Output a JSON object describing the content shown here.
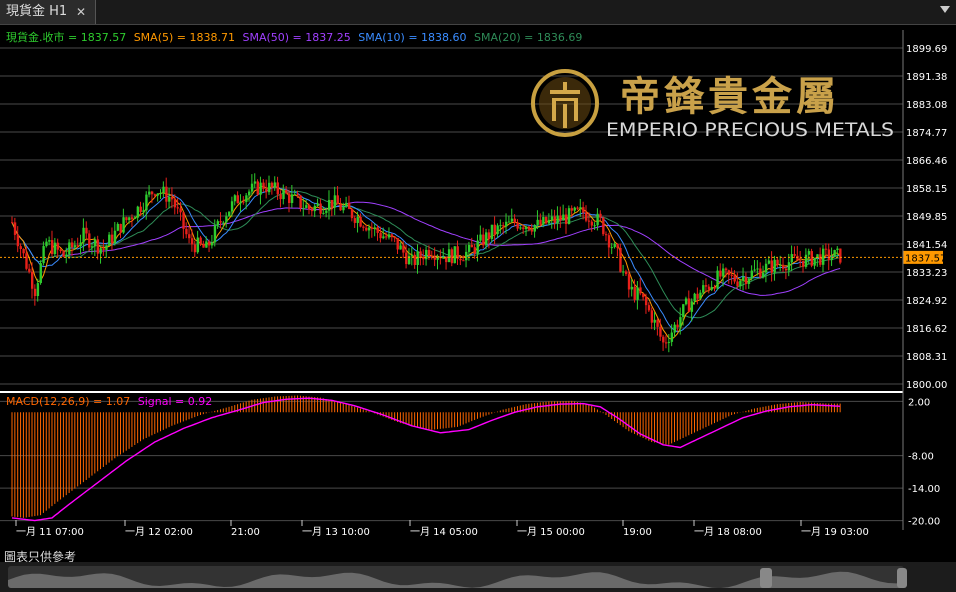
{
  "window": {
    "tab_title": "現貨金 H1",
    "close_glyph": "✕",
    "footer_text": "圖表只供參考"
  },
  "logo": {
    "chinese": "帝鋒貴金屬",
    "english": "EMPERIO PRECIOUS METALS"
  },
  "legend": {
    "price": "現貨金.收市 = 1837.57",
    "sma5": "SMA(5) = 1838.71",
    "sma50": "SMA(50) = 1837.25",
    "sma10": "SMA(10) = 1838.60",
    "sma20": "SMA(20) = 1836.69"
  },
  "macd_legend": {
    "macd": "MACD(12,26,9) = 1.07",
    "signal": "Signal = 0.92"
  },
  "colors": {
    "up": "#2ecc2e",
    "down": "#e8201a",
    "price_line": "#ff9900",
    "sma5": "#ff9900",
    "sma10": "#3a8cff",
    "sma20": "#2e8b57",
    "sma50": "#a040ff",
    "macd_hist": "#ff6600",
    "signal": "#ff00ff",
    "grid": "#4a4a4a",
    "axis_text": "#ffffff"
  },
  "chart_data": {
    "type": "candlestick",
    "timeframe": "H1",
    "instrument": "現貨金",
    "current_price": 1837.57,
    "current_price_label": "1837.57",
    "y_ticks": [
      "1899.69",
      "1891.38",
      "1883.08",
      "1874.77",
      "1866.46",
      "1858.15",
      "1849.85",
      "1841.54",
      "1833.23",
      "1824.92",
      "1816.62",
      "1808.31",
      "1800.00"
    ],
    "ylim": [
      1800.0,
      1899.69
    ],
    "x_tick_labels": [
      "一月 11 07:00",
      "一月 12 02:00",
      "21:00",
      "一月 13 10:00",
      "一月 14 05:00",
      "一月 15 00:00",
      "19:00",
      "一月 18 08:00",
      "一月 19 03:00"
    ],
    "price_anchors": [
      [
        0,
        1848
      ],
      [
        4,
        1838
      ],
      [
        8,
        1828
      ],
      [
        12,
        1842
      ],
      [
        18,
        1838
      ],
      [
        25,
        1844
      ],
      [
        32,
        1840
      ],
      [
        38,
        1847
      ],
      [
        44,
        1852
      ],
      [
        50,
        1858
      ],
      [
        56,
        1855
      ],
      [
        62,
        1842
      ],
      [
        68,
        1840
      ],
      [
        74,
        1850
      ],
      [
        80,
        1856
      ],
      [
        88,
        1859
      ],
      [
        96,
        1856
      ],
      [
        104,
        1852
      ],
      [
        112,
        1854
      ],
      [
        120,
        1850
      ],
      [
        128,
        1845
      ],
      [
        134,
        1842
      ],
      [
        140,
        1836
      ],
      [
        146,
        1840
      ],
      [
        152,
        1838
      ],
      [
        160,
        1839
      ],
      [
        168,
        1845
      ],
      [
        176,
        1848
      ],
      [
        184,
        1847
      ],
      [
        192,
        1849
      ],
      [
        200,
        1851
      ],
      [
        206,
        1848
      ],
      [
        212,
        1838
      ],
      [
        216,
        1828
      ],
      [
        220,
        1826
      ],
      [
        224,
        1820
      ],
      [
        228,
        1812
      ],
      [
        232,
        1817
      ],
      [
        236,
        1823
      ],
      [
        242,
        1828
      ],
      [
        248,
        1832
      ],
      [
        254,
        1831
      ],
      [
        262,
        1834
      ],
      [
        270,
        1836
      ],
      [
        278,
        1837
      ],
      [
        286,
        1838
      ],
      [
        290,
        1838
      ]
    ],
    "macd": {
      "title": "MACD(12,26,9)",
      "macd_value": 1.07,
      "signal_value": 0.92,
      "y_ticks": [
        "2.00",
        "-8.00",
        "-14.00",
        "-20.00"
      ],
      "ylim": [
        -21,
        3
      ],
      "signal_anchors": [
        [
          0,
          -19.5
        ],
        [
          8,
          -20
        ],
        [
          14,
          -19.5
        ],
        [
          20,
          -17
        ],
        [
          30,
          -13
        ],
        [
          40,
          -9
        ],
        [
          50,
          -5.5
        ],
        [
          60,
          -3
        ],
        [
          70,
          -1
        ],
        [
          80,
          0.5
        ],
        [
          88,
          1.8
        ],
        [
          96,
          2.4
        ],
        [
          104,
          2.6
        ],
        [
          112,
          2.2
        ],
        [
          120,
          1.2
        ],
        [
          130,
          -0.5
        ],
        [
          140,
          -2.5
        ],
        [
          150,
          -3.8
        ],
        [
          160,
          -3.2
        ],
        [
          168,
          -1.5
        ],
        [
          176,
          0
        ],
        [
          184,
          1
        ],
        [
          192,
          1.5
        ],
        [
          200,
          1.6
        ],
        [
          206,
          1
        ],
        [
          212,
          -1
        ],
        [
          220,
          -4
        ],
        [
          228,
          -6
        ],
        [
          234,
          -6.5
        ],
        [
          240,
          -5
        ],
        [
          248,
          -3
        ],
        [
          256,
          -1
        ],
        [
          264,
          0.2
        ],
        [
          272,
          1
        ],
        [
          280,
          1.4
        ],
        [
          290,
          1.1
        ]
      ]
    }
  }
}
